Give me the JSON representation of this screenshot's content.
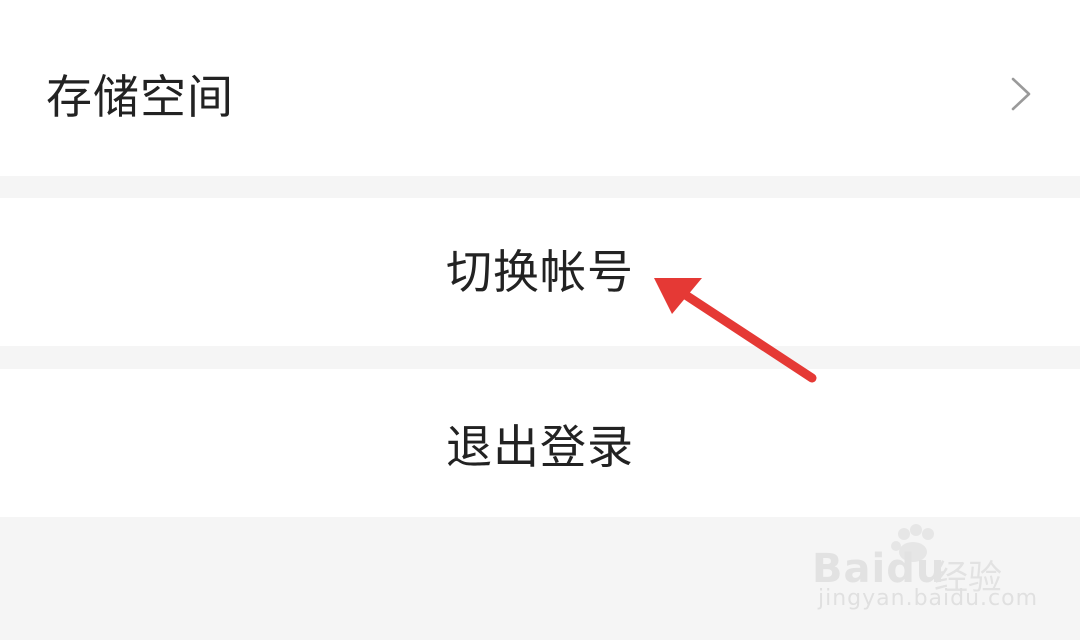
{
  "settings": {
    "items": [
      {
        "label": "存储空间"
      },
      {
        "label": "切换帐号"
      },
      {
        "label": "退出登录"
      }
    ]
  },
  "icons": {
    "chevron": "chevron-right-icon",
    "annotation": "red-arrow"
  },
  "watermark": {
    "brand": "Baidu",
    "brand_cn": "经验",
    "url": "jingyan.baidu.com"
  },
  "colors": {
    "background": "#f5f5f5",
    "row": "#ffffff",
    "text": "#222222",
    "chevron": "#9a9a9a",
    "arrow": "#e53935"
  }
}
